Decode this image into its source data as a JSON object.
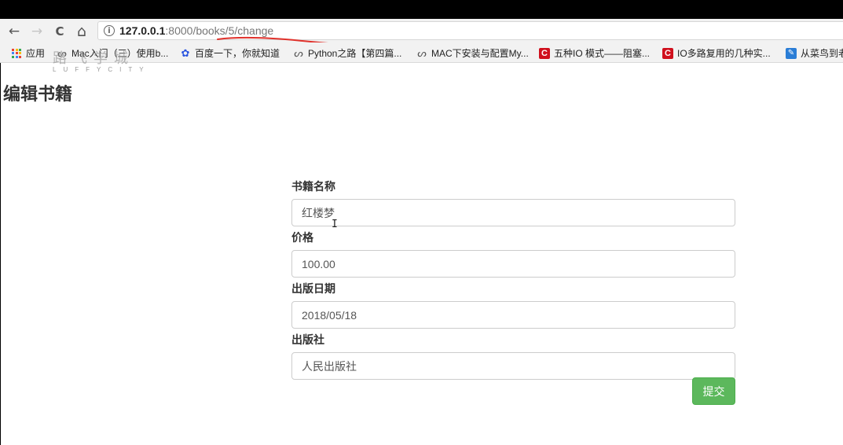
{
  "browser": {
    "url_host": "127.0.0.1",
    "url_port": ":8000",
    "url_path": "/books/5/change",
    "info_symbol": "i",
    "back_symbol": "←",
    "forward_symbol": "→",
    "reload_symbol": "C",
    "home_symbol": "⌂"
  },
  "bookmarks": [
    {
      "label": "应用",
      "icon": "apps-grid-icon"
    },
    {
      "label": "Mac入门（三）使用b...",
      "icon": "cnblogs-icon"
    },
    {
      "label": "百度一下，你就知道",
      "icon": "baidu-paw-icon"
    },
    {
      "label": "Python之路【第四篇...",
      "icon": "cnblogs-icon"
    },
    {
      "label": "MAC下安装与配置My...",
      "icon": "cnblogs-icon"
    },
    {
      "label": "五种IO 模式——阻塞...",
      "icon": "csdn-icon",
      "icon_text": "C"
    },
    {
      "label": "IO多路复用的几种实...",
      "icon": "csdn-icon",
      "icon_text": "C"
    },
    {
      "label": "从菜鸟到老",
      "icon": "note-icon"
    }
  ],
  "watermark": {
    "cn": "路飞学城",
    "en": "LUFFYCITY"
  },
  "page": {
    "title": "编辑书籍",
    "fields": [
      {
        "label": "书籍名称",
        "value": "红楼梦"
      },
      {
        "label": "价格",
        "value": "100.00"
      },
      {
        "label": "出版日期",
        "value": "2018/05/18"
      },
      {
        "label": "出版社",
        "value": "人民出版社"
      }
    ],
    "submit_label": "提交",
    "text_cursor": "I"
  },
  "colors": {
    "submit_bg": "#5cb85c",
    "annotation_line": "#e0312b",
    "apps_grid": [
      "#e94235",
      "#fbbc05",
      "#34a853",
      "#4285f4",
      "#e94235",
      "#fbbc05",
      "#34a853",
      "#4285f4",
      "#e94235"
    ]
  }
}
